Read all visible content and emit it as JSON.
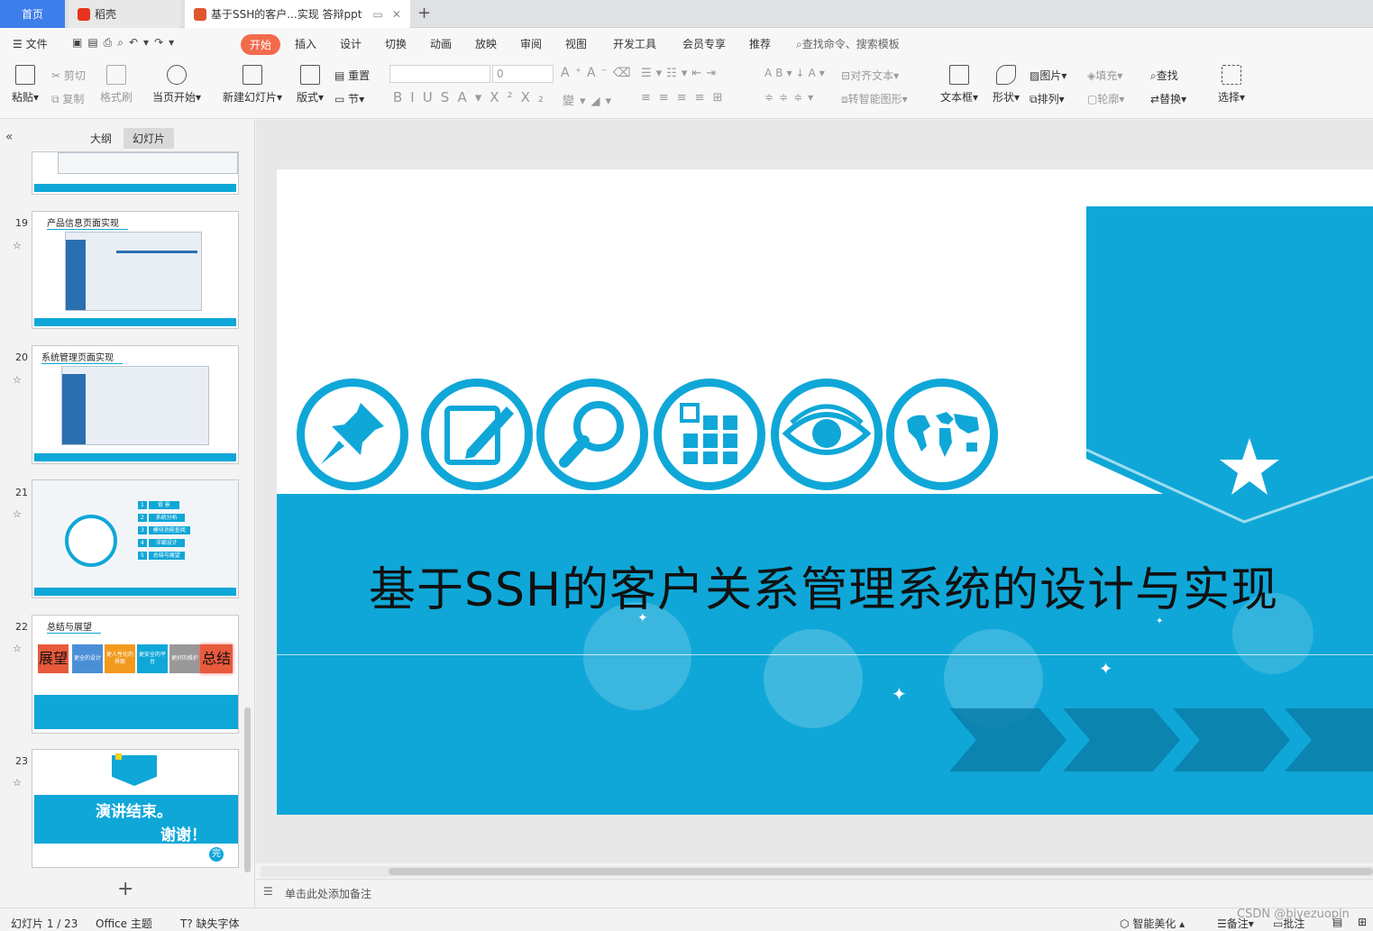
{
  "tabs": {
    "home": "首页",
    "daoke": "稻壳",
    "doc": "基于SSH的客户...实现 答辩ppt"
  },
  "menu": {
    "file": "文件",
    "items": [
      "开始",
      "插入",
      "设计",
      "切换",
      "动画",
      "放映",
      "审阅",
      "视图",
      "开发工具",
      "会员专享",
      "推荐"
    ],
    "search": "查找命令、搜索模板"
  },
  "ribbon": {
    "paste": "粘贴",
    "cut": "剪切",
    "copy": "复制",
    "format_painter": "格式刷",
    "from_current": "当页开始",
    "new_slide": "新建幻灯片",
    "layout": "版式",
    "reset": "重置",
    "section": "节",
    "font_size": "0",
    "align_text": "对齐文本",
    "smart_shape": "转智能图形",
    "textbox": "文本框",
    "shape": "形状",
    "picture": "图片",
    "fill": "填充",
    "arrange": "排列",
    "outline": "轮廓",
    "find": "查找",
    "replace": "替换",
    "select": "选择"
  },
  "panel": {
    "outline_tab": "大纲",
    "slides_tab": "幻灯片",
    "add": "+"
  },
  "thumbs": [
    {
      "num": "19",
      "title": "产品信息页面实现"
    },
    {
      "num": "20",
      "title": "系统管理页面实现"
    },
    {
      "num": "21",
      "items": [
        "背 景",
        "系统分析",
        "模块功能查阅",
        "详细设计",
        "总结与展望"
      ]
    },
    {
      "num": "22",
      "title": "总结与展望",
      "tags": [
        "展望",
        "更全的设计",
        "更人性化的界面",
        "更安全的平台",
        "更好的维护",
        "总结"
      ]
    },
    {
      "num": "23",
      "line1": "演讲结束。",
      "line2": "谢谢！",
      "badge": "完"
    }
  ],
  "slide": {
    "title": "基于SSH的客户关系管理系统的设计与实现",
    "accent": "#0fa7d8"
  },
  "notes": {
    "placeholder": "单击此处添加备注"
  },
  "status": {
    "slide_info": "幻灯片 1 / 23",
    "theme": "Office 主题",
    "missing_font": "缺失字体",
    "beautify": "智能美化",
    "notes": "备注",
    "comments": "批注",
    "watermark": "CSDN @biyezuopin"
  }
}
